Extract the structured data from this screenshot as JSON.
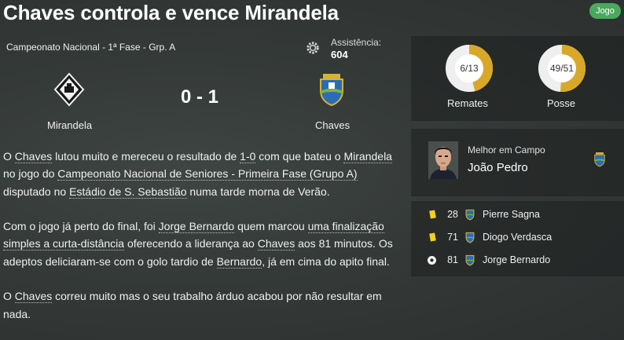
{
  "header": {
    "title": "Chaves controla e vence Mirandela",
    "badge": "Jogo"
  },
  "match": {
    "competition": "Campeonato Nacional - 1ª Fase - Grp. A",
    "attendance_label": "Assistência:",
    "attendance_value": "604",
    "home_team": "Mirandela",
    "away_team": "Chaves",
    "score": "0 - 1"
  },
  "stats": {
    "shots": {
      "value": "6/13",
      "label": "Remates",
      "fraction": 0.46
    },
    "possession": {
      "value": "49/51",
      "label": "Posse",
      "fraction": 0.51
    },
    "accent_color": "#d8a928"
  },
  "best_player": {
    "label": "Melhor em Campo",
    "name": "João Pedro"
  },
  "events": [
    {
      "type": "yellow-card",
      "minute": "28",
      "player": "Pierre Sagna"
    },
    {
      "type": "yellow-card",
      "minute": "71",
      "player": "Diogo Verdasca"
    },
    {
      "type": "goal",
      "minute": "81",
      "player": "Jorge Bernardo"
    }
  ],
  "article": {
    "p1": {
      "s1": "O ",
      "l1": "Chaves",
      "s2": " lutou muito e mereceu o resultado de ",
      "l2": "1-0",
      "s3": " com que bateu o ",
      "l3": "Mirandela",
      "s4": " no jogo do ",
      "l4": "Campeonato Nacional de Seniores - Primeira Fase (Grupo A)",
      "s5": " disputado no ",
      "l5": "Estádio de S. Sebastião",
      "s6": " numa tarde morna de Verão."
    },
    "p2": {
      "s1": "Com o jogo já perto do final, foi ",
      "l1": "Jorge Bernardo",
      "s2": " quem marcou ",
      "l2": "uma finalização simples a curta-distância",
      "s3": " oferecendo a liderança ao ",
      "l3": "Chaves",
      "s4": " aos 81 minutos. Os adeptos deliciaram-se com o golo tardio de ",
      "l4": "Bernardo",
      "s5": ", já em cima do apito final."
    },
    "p3": {
      "s1": "O ",
      "l1": "Chaves",
      "s2": " correu muito mas o seu trabalho árduo acabou por não resultar em nada."
    }
  }
}
